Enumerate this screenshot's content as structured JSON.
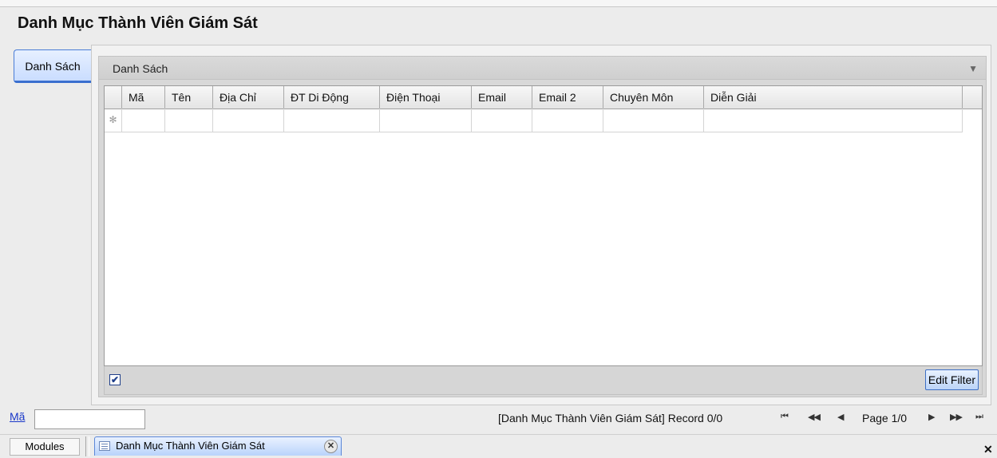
{
  "window": {
    "title": "Danh Mục Thành Viên Giám Sát"
  },
  "side_tab": {
    "label": "Danh Sách"
  },
  "group": {
    "title": "Danh Sách",
    "collapse_icon": "triangle-down-icon"
  },
  "grid": {
    "columns": [
      "Mã",
      "Tên",
      "Địa Chỉ",
      "ĐT Di Động",
      "Điện Thoại",
      "Email",
      "Email 2",
      "Chuyên Môn",
      "Diễn Giải"
    ],
    "new_row_marker": "✻",
    "rows": []
  },
  "grid_footer": {
    "filter_checkbox_mark": "✔",
    "filter_checked": true,
    "edit_filter_label": "Edit Filter"
  },
  "status_bar": {
    "search_label": "Mã",
    "search_value": "",
    "record_info": "[Danh Mục Thành Viên Giám Sát] Record 0/0",
    "nav_first": "⏮",
    "nav_prev_page": "◀◀",
    "nav_prev": "◀",
    "page_info": "Page 1/0",
    "nav_next": "▶",
    "nav_next_page": "▶▶",
    "nav_last": "⏭"
  },
  "taskbar": {
    "modules_label": "Modules",
    "open_tab_label": "Danh Mục Thành Viên Giám Sát",
    "tab_close_glyph": "✕",
    "app_close_glyph": "✕"
  },
  "colors": {
    "accent": "#3a6fcf",
    "link": "#1a38c9",
    "tab_gradient_top": "#eaf2ff",
    "tab_gradient_bottom": "#b9d3fb"
  }
}
